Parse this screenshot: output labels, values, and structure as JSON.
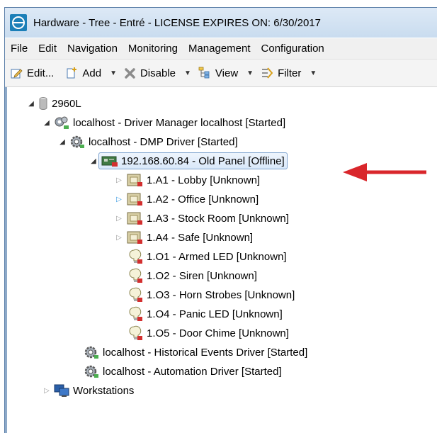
{
  "window": {
    "title": "Hardware - Tree - Entré - LICENSE EXPIRES ON: 6/30/2017"
  },
  "menu": [
    "File",
    "Edit",
    "Navigation",
    "Monitoring",
    "Management",
    "Configuration"
  ],
  "toolbar": {
    "edit": "Edit...",
    "add": "Add",
    "disable": "Disable",
    "view": "View",
    "filter": "Filter"
  },
  "tree": {
    "root": "2960L",
    "driver_manager": "localhost - Driver Manager localhost [Started]",
    "dmp_driver": "localhost - DMP Driver [Started]",
    "panel": "192.168.60.84 - Old Panel [Offline]",
    "areas": [
      "1.A1 - Lobby [Unknown]",
      "1.A2 - Office [Unknown]",
      "1.A3 - Stock Room [Unknown]",
      "1.A4 - Safe [Unknown]"
    ],
    "outputs": [
      "1.O1 - Armed LED [Unknown]",
      "1.O2 - Siren [Unknown]",
      "1.O3 - Horn Strobes [Unknown]",
      "1.O4 - Panic LED [Unknown]",
      "1.O5 - Door Chime [Unknown]"
    ],
    "historical_driver": "localhost - Historical Events Driver [Started]",
    "automation_driver": "localhost - Automation Driver [Started]",
    "workstations": "Workstations"
  },
  "colors": {
    "annotation_arrow": "#d9262b",
    "selection_border": "#7da2ce",
    "title_bar": "#d3e3f3"
  }
}
